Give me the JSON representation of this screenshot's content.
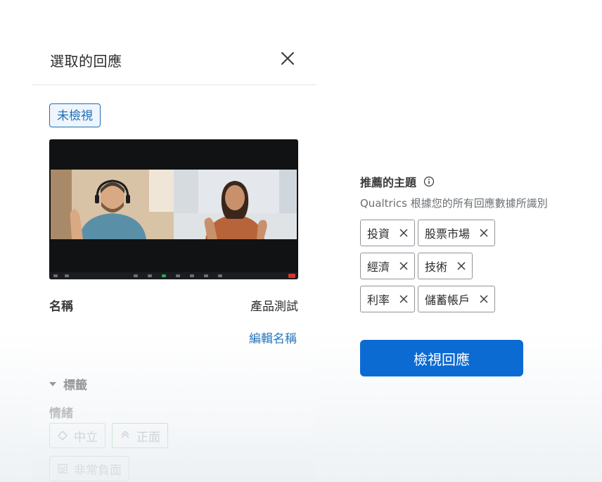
{
  "panel": {
    "title": "選取的回應",
    "status_tag": "未檢視",
    "name_label": "名稱",
    "name_value": "產品測試",
    "edit_name_link": "編輯名稱",
    "tags_section_label": "標籤",
    "emotion_label": "情緒",
    "sentiment_chips": [
      {
        "label": "中立",
        "icon": "diamond-icon"
      },
      {
        "label": "正面",
        "icon": "chevron-up-icon"
      },
      {
        "label": "非常負面",
        "icon": "double-chevron-down-icon"
      }
    ]
  },
  "topics": {
    "title": "推薦的主題",
    "subtitle": "Qualtrics 根據您的所有回應數據所識別",
    "items": [
      "投資",
      "股票市場",
      "經濟",
      "技術",
      "利率",
      "儲蓄帳戶"
    ]
  },
  "actions": {
    "view_responses": "檢視回應"
  },
  "colors": {
    "accent": "#0b6bd3",
    "link": "#1d6fb8",
    "positive": "#9bd49b"
  }
}
